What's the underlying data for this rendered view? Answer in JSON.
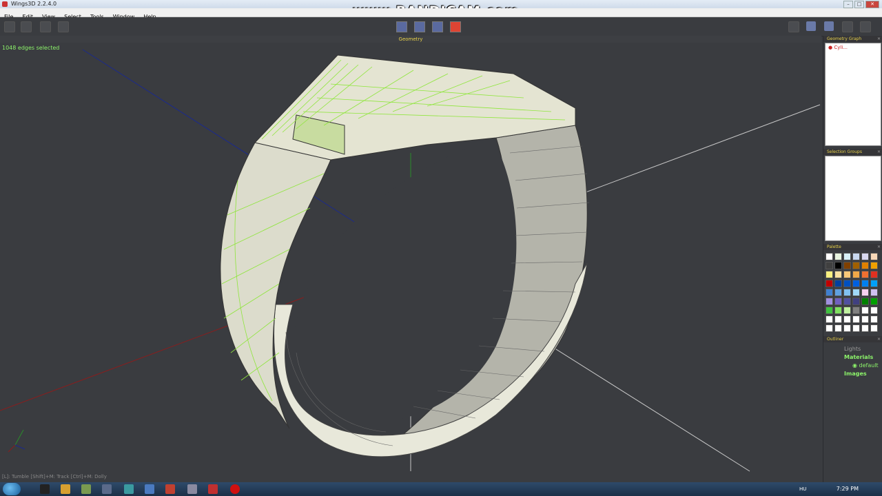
{
  "window": {
    "title": "Wings3D 2.2.4.0",
    "watermark": "www.BANDICAM.com"
  },
  "menu": [
    "File",
    "Edit",
    "View",
    "Select",
    "Tools",
    "Window",
    "Help"
  ],
  "viewport": {
    "header": "Geometry",
    "status_top": "1048 edges selected",
    "status_bottom": "[L]: Tumble    [Shift]+M: Track    [Ctrl]+M: Dolly"
  },
  "panels": {
    "geometry_graph": {
      "title": "Geometry Graph",
      "item": "Cyli..."
    },
    "selection_groups": {
      "title": "Selection Groups"
    },
    "palette": {
      "title": "Palette",
      "swatches": [
        "#ffffff",
        "#e8f4e0",
        "#d8f0f8",
        "#c8d8f0",
        "#d8d8f0",
        "#f8d8b8",
        "#404040",
        "#000000",
        "#804000",
        "#a06000",
        "#e08000",
        "#f0a000",
        "#f8f080",
        "#f8e0a0",
        "#f8c878",
        "#f0a848",
        "#f07030",
        "#e03020",
        "#c00000",
        "#0040a0",
        "#0050c0",
        "#0060e0",
        "#0080f0",
        "#00a0f8",
        "#4080d0",
        "#60a0e0",
        "#80c0f0",
        "#a0d8f8",
        "#f8d0f0",
        "#d0c0f0",
        "#a090e0",
        "#7060c0",
        "#5050a0",
        "#404080",
        "#008000",
        "#00a000",
        "#40c040",
        "#80e060",
        "#c0f0a0",
        "#808080",
        "#ffffff",
        "#ffffff",
        "#ffffff",
        "#ffffff",
        "#ffffff",
        "#ffffff",
        "#ffffff",
        "#ffffff",
        "#ffffff",
        "#ffffff",
        "#ffffff",
        "#ffffff",
        "#ffffff",
        "#ffffff"
      ]
    },
    "outliner": {
      "title": "Outliner",
      "items": [
        "Lights",
        "Materials",
        "default",
        "Images"
      ]
    }
  },
  "taskbar": {
    "lang": "HU",
    "time": "7:29 PM"
  }
}
